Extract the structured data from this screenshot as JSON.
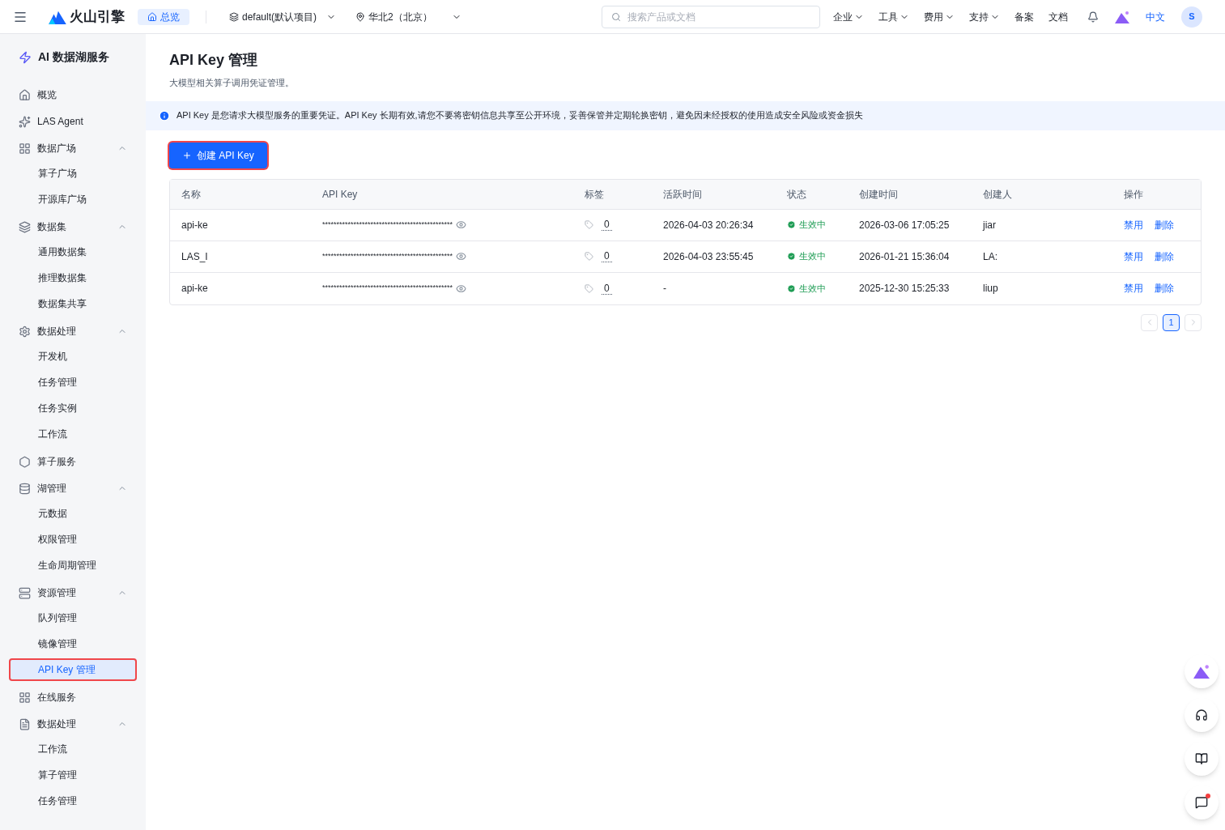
{
  "topbar": {
    "brand": "火山引擎",
    "home_tab": "总览",
    "project": "default(默认项目)",
    "region": "华北2（北京）",
    "search": {
      "placeholder": "搜索产品或文档"
    },
    "menus": [
      {
        "label": "企业",
        "dropdown": true
      },
      {
        "label": "工具",
        "dropdown": true
      },
      {
        "label": "费用",
        "dropdown": true
      },
      {
        "label": "支持",
        "dropdown": true
      },
      {
        "label": "备案",
        "dropdown": false
      },
      {
        "label": "文档",
        "dropdown": false
      }
    ],
    "language": {
      "label": "中文",
      "selected": true
    },
    "avatar": "S"
  },
  "sidebar": {
    "title": "AI 数据湖服务",
    "items": [
      {
        "label": "概览"
      },
      {
        "label": "LAS Agent"
      },
      {
        "label": "数据广场",
        "expanded": true,
        "children": [
          {
            "label": "算子广场",
            "selected": false
          },
          {
            "label": "开源库广场",
            "selected": false
          }
        ]
      },
      {
        "label": "数据集",
        "expanded": true,
        "children": [
          {
            "label": "通用数据集",
            "selected": false
          },
          {
            "label": "推理数据集",
            "selected": false
          },
          {
            "label": "数据集共享",
            "selected": false
          }
        ]
      },
      {
        "label": "数据处理",
        "expanded": true,
        "children": [
          {
            "label": "开发机",
            "selected": false
          },
          {
            "label": "任务管理",
            "selected": false
          },
          {
            "label": "任务实例",
            "selected": false
          },
          {
            "label": "工作流",
            "selected": false
          }
        ]
      },
      {
        "label": "算子服务"
      },
      {
        "label": "湖管理",
        "expanded": true,
        "children": [
          {
            "label": "元数据",
            "selected": false
          },
          {
            "label": "权限管理",
            "selected": false
          },
          {
            "label": "生命周期管理",
            "selected": false
          }
        ]
      },
      {
        "label": "资源管理",
        "expanded": true,
        "children": [
          {
            "label": "队列管理",
            "selected": false
          },
          {
            "label": "镜像管理",
            "selected": false
          },
          {
            "label": "API Key 管理",
            "selected": true
          }
        ]
      },
      {
        "label": "在线服务"
      },
      {
        "label": "数据处理",
        "expanded": true,
        "children": [
          {
            "label": "工作流",
            "selected": false
          },
          {
            "label": "算子管理",
            "selected": false
          },
          {
            "label": "任务管理",
            "selected": false
          }
        ]
      }
    ]
  },
  "page": {
    "title": "API Key 管理",
    "subtitle": "大模型相关算子调用凭证管理。",
    "notice": "API Key 是您请求大模型服务的重要凭证。API Key 长期有效,请您不要将密钥信息共享至公开环境，妥善保管并定期轮换密钥，避免因未经授权的使用造成安全风险或资金损失",
    "create_button": "创建 API Key"
  },
  "table": {
    "columns": [
      "名称",
      "API Key",
      "标签",
      "活跃时间",
      "状态",
      "创建时间",
      "创建人",
      "操作"
    ],
    "rows": [
      {
        "name": "api-ke",
        "key": "**********************************************",
        "tags": "0",
        "active": "2026-04-03 20:26:34",
        "status": "生效中",
        "created": "2026-03-06 17:05:25",
        "creator": "jiar",
        "actions": [
          "禁用",
          "删除"
        ]
      },
      {
        "name": "LAS_I",
        "key": "**********************************************",
        "tags": "0",
        "active": "2026-04-03 23:55:45",
        "status": "生效中",
        "created": "2026-01-21 15:36:04",
        "creator": "LA:",
        "actions": [
          "禁用",
          "删除"
        ]
      },
      {
        "name": "api-ke",
        "key": "**********************************************",
        "tags": "0",
        "active": "-",
        "status": "生效中",
        "created": "2025-12-30 15:25:33",
        "creator": "liup",
        "actions": [
          "禁用",
          "删除"
        ]
      }
    ]
  },
  "pagination": {
    "pages": [
      {
        "label": "1",
        "selected": true
      }
    ]
  }
}
